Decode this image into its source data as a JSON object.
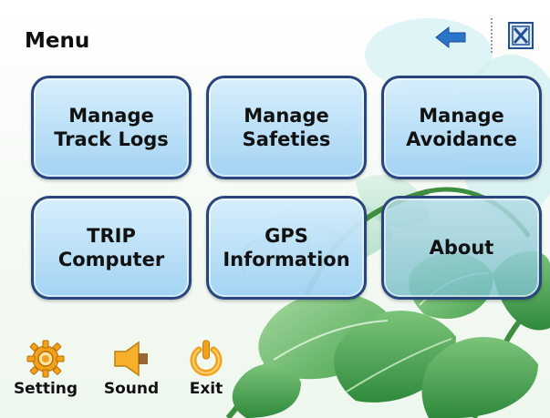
{
  "header": {
    "title": "Menu",
    "back_icon": "back-arrow-icon",
    "close_icon": "close-icon"
  },
  "menu_buttons": [
    {
      "label": "Manage\nTrack Logs"
    },
    {
      "label": "Manage\nSafeties"
    },
    {
      "label": "Manage\nAvoidance"
    },
    {
      "label": "TRIP\nComputer"
    },
    {
      "label": "GPS\nInformation"
    },
    {
      "label": "About"
    }
  ],
  "bottom_bar": {
    "setting": {
      "label": "Setting",
      "icon": "gear-icon"
    },
    "sound": {
      "label": "Sound",
      "icon": "speaker-icon"
    },
    "exit": {
      "label": "Exit",
      "icon": "power-icon"
    }
  },
  "colors": {
    "tile_border": "#28457d",
    "tile_fill": "#b8dff6",
    "back_arrow": "#2a74c9",
    "icon_orange": "#f2a21a",
    "leaf_green": "#3f9a48"
  }
}
